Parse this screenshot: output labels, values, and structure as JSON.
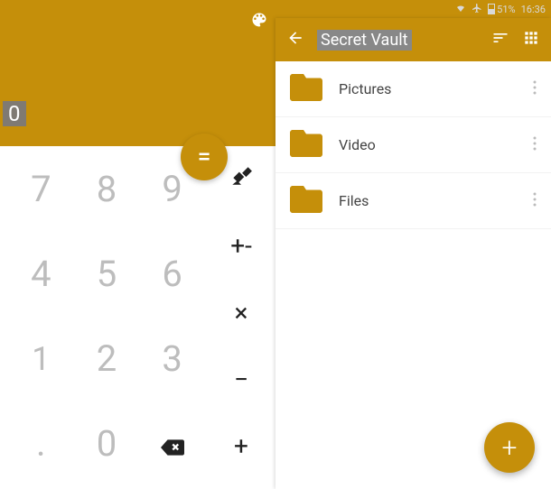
{
  "statusbar": {
    "battery_pct": "51%",
    "time": "16:36"
  },
  "calc": {
    "display": "0",
    "equals": "=",
    "keys": {
      "k7": "7",
      "k8": "8",
      "k9": "9",
      "k4": "4",
      "k5": "5",
      "k6": "6",
      "k1": "1",
      "k2": "2",
      "k3": "3",
      "dot": ".",
      "k0": "0"
    },
    "ops": {
      "plusminus": "+-",
      "multiply": "×",
      "minus": "−",
      "plus": "+"
    }
  },
  "vault": {
    "title": "Secret Vault",
    "folders": [
      {
        "label": "Pictures"
      },
      {
        "label": "Video"
      },
      {
        "label": "Files"
      }
    ],
    "fab": "+"
  }
}
